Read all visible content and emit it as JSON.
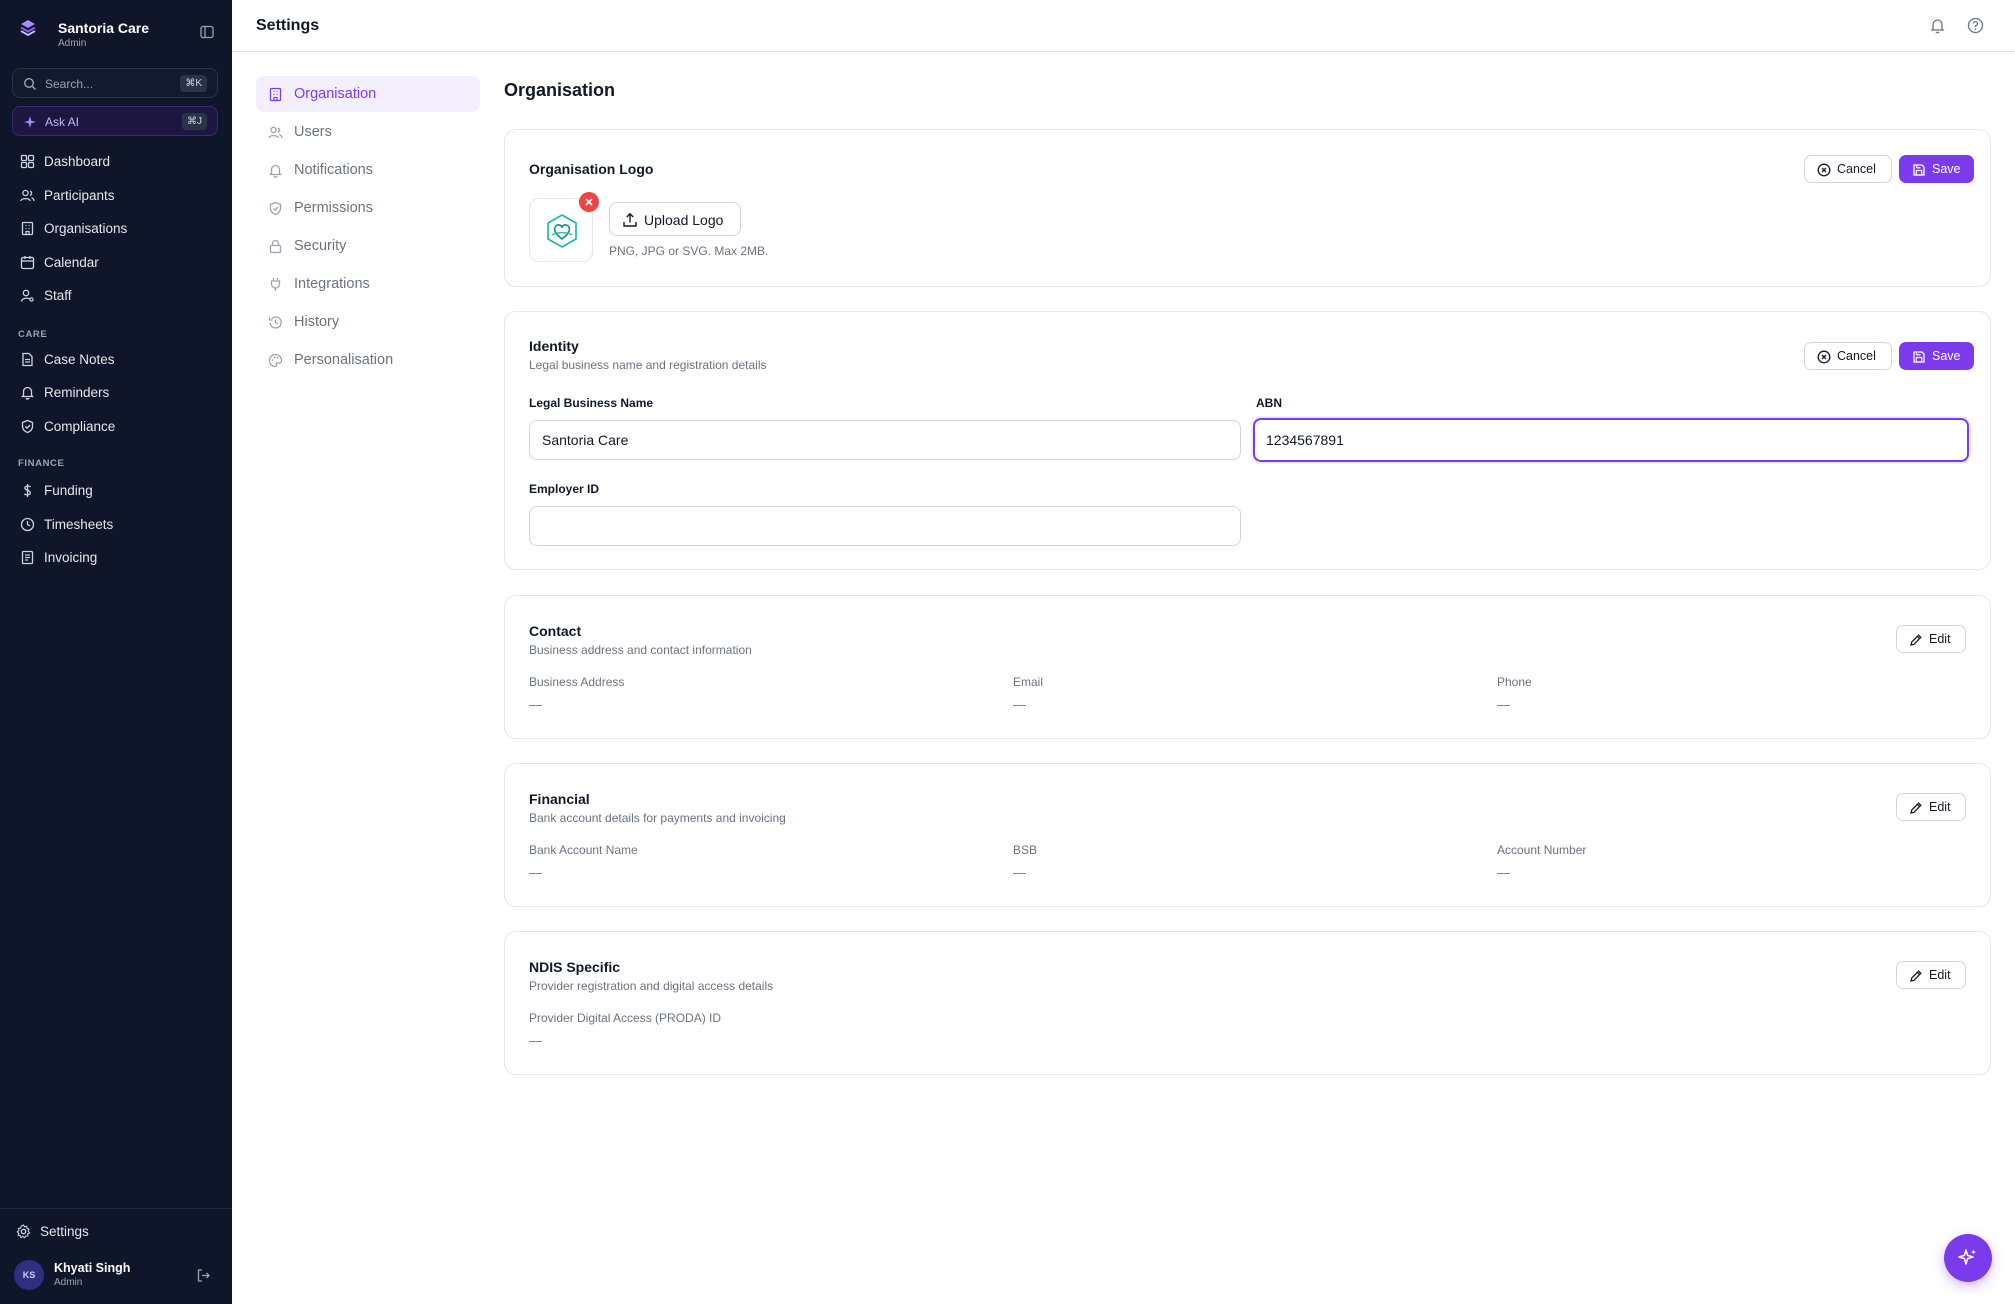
{
  "brand": {
    "name": "Santoria Care",
    "role": "Admin"
  },
  "search": {
    "placeholder": "Search...",
    "shortcut": "⌘K"
  },
  "ask_ai": {
    "label": "Ask AI",
    "shortcut": "⌘J"
  },
  "nav": {
    "main": [
      {
        "label": "Dashboard",
        "icon": "grid-icon"
      },
      {
        "label": "Participants",
        "icon": "users-icon"
      },
      {
        "label": "Organisations",
        "icon": "building-icon"
      },
      {
        "label": "Calendar",
        "icon": "calendar-icon"
      },
      {
        "label": "Staff",
        "icon": "staff-icon"
      }
    ],
    "care_heading": "CARE",
    "care": [
      {
        "label": "Case Notes",
        "icon": "file-icon"
      },
      {
        "label": "Reminders",
        "icon": "bell-icon"
      },
      {
        "label": "Compliance",
        "icon": "shield-icon"
      }
    ],
    "finance_heading": "FINANCE",
    "finance": [
      {
        "label": "Funding",
        "icon": "dollar-icon"
      },
      {
        "label": "Timesheets",
        "icon": "clock-icon"
      },
      {
        "label": "Invoicing",
        "icon": "invoice-icon"
      }
    ],
    "settings_label": "Settings"
  },
  "user": {
    "initials": "KS",
    "name": "Khyati Singh",
    "role": "Admin"
  },
  "header": {
    "title": "Settings"
  },
  "settings_nav": [
    {
      "label": "Organisation",
      "active": true
    },
    {
      "label": "Users"
    },
    {
      "label": "Notifications"
    },
    {
      "label": "Permissions"
    },
    {
      "label": "Security"
    },
    {
      "label": "Integrations"
    },
    {
      "label": "History"
    },
    {
      "label": "Personalisation"
    }
  ],
  "main": {
    "title": "Organisation",
    "buttons": {
      "cancel": "Cancel",
      "save": "Save",
      "edit": "Edit"
    },
    "logo_card": {
      "title": "Organisation Logo",
      "upload_label": "Upload Logo",
      "hint": "PNG, JPG or SVG. Max 2MB."
    },
    "identity": {
      "title": "Identity",
      "subtitle": "Legal business name and registration details",
      "legal_name_label": "Legal Business Name",
      "legal_name_value": "Santoria Care",
      "abn_label": "ABN",
      "abn_value": "1234567891",
      "employer_id_label": "Employer ID",
      "employer_id_value": ""
    },
    "contact": {
      "title": "Contact",
      "subtitle": "Business address and contact information",
      "fields": [
        {
          "label": "Business Address",
          "value": "—"
        },
        {
          "label": "Email",
          "value": "—"
        },
        {
          "label": "Phone",
          "value": "—"
        }
      ]
    },
    "financial": {
      "title": "Financial",
      "subtitle": "Bank account details for payments and invoicing",
      "fields": [
        {
          "label": "Bank Account Name",
          "value": "—"
        },
        {
          "label": "BSB",
          "value": "—"
        },
        {
          "label": "Account Number",
          "value": "—"
        }
      ]
    },
    "ndis": {
      "title": "NDIS Specific",
      "subtitle": "Provider registration and digital access details",
      "fields": [
        {
          "label": "Provider Digital Access (PRODA) ID",
          "value": "—"
        }
      ]
    }
  },
  "colors": {
    "accent": "#7c3aed",
    "sidebar_bg": "#0f1629",
    "danger": "#ef4444"
  }
}
